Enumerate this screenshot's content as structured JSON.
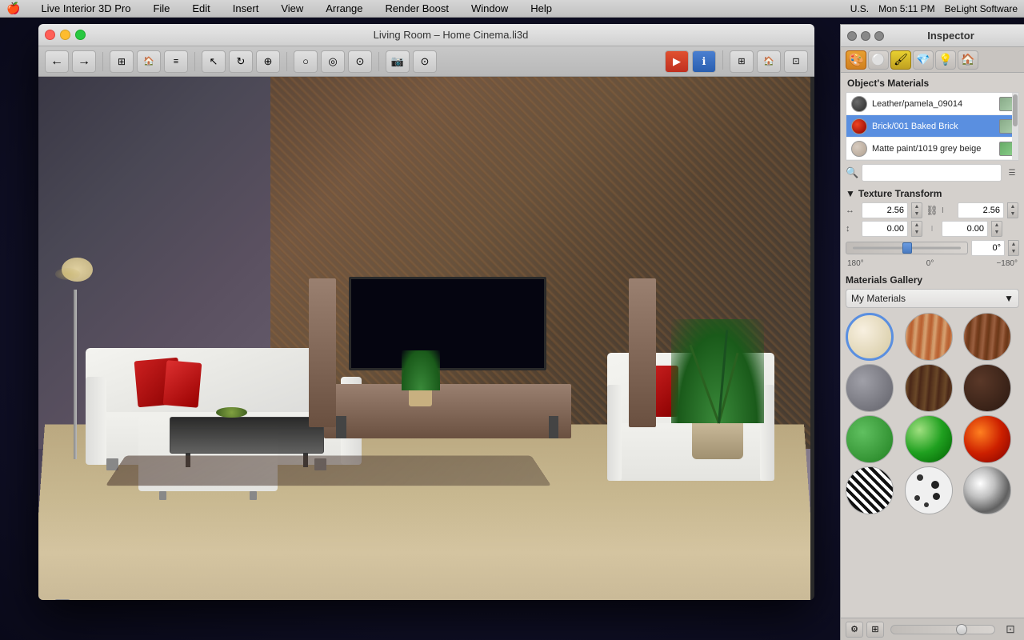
{
  "menubar": {
    "apple": "🍎",
    "app_name": "Live Interior 3D Pro",
    "menus": [
      "File",
      "Edit",
      "Insert",
      "View",
      "Arrange",
      "Render Boost",
      "Window",
      "Help"
    ],
    "right": {
      "time": "Mon 5:11 PM",
      "company": "BeLight Software",
      "locale": "U.S."
    }
  },
  "window": {
    "title": "Living Room – Home Cinema.li3d",
    "traffic_lights": [
      "close",
      "minimize",
      "maximize"
    ]
  },
  "toolbar": {
    "nav_back": "←",
    "nav_forward": "→",
    "tools": [
      "select",
      "rotate",
      "move"
    ],
    "mode_tools": [
      "circle",
      "target",
      "ring"
    ],
    "special_tools": [
      "camera",
      "screenshot"
    ],
    "info_btn": "ℹ",
    "view_btns": [
      "grid",
      "house",
      "rooms"
    ]
  },
  "inspector": {
    "title": "Inspector",
    "tabs": [
      {
        "id": "materials",
        "icon": "🎨",
        "label": "Materials",
        "active": true
      },
      {
        "id": "sphere",
        "icon": "⚪",
        "label": "Object"
      },
      {
        "id": "paint",
        "icon": "🖌️",
        "label": "Paint",
        "active_tab": true
      },
      {
        "id": "gem",
        "icon": "💎",
        "label": "Gem"
      },
      {
        "id": "bulb",
        "icon": "💡",
        "label": "Light"
      },
      {
        "id": "house",
        "icon": "🏠",
        "label": "Rooms"
      }
    ],
    "objects_materials": {
      "header": "Object's Materials",
      "items": [
        {
          "id": 1,
          "name": "Leather/pamela_09014",
          "swatch_color": "#4a4a4a",
          "selected": false
        },
        {
          "id": 2,
          "name": "Brick/001 Baked Brick",
          "swatch_color": "#cc3322",
          "selected": true
        },
        {
          "id": 3,
          "name": "Matte paint/1019 grey beige",
          "swatch_color": "#ccbbaa",
          "selected": false
        }
      ],
      "search_placeholder": ""
    },
    "texture_transform": {
      "header": "Texture Transform",
      "collapsed": false,
      "width_val": "2.56",
      "height_val": "2.56",
      "x_offset": "0.00",
      "y_offset": "0.00",
      "rotation_val": "0°",
      "rotation_left_label": "180°",
      "rotation_center_label": "0°",
      "rotation_right_label": "−180°"
    },
    "materials_gallery": {
      "header": "Materials Gallery",
      "dropdown_value": "My Materials",
      "items": [
        {
          "id": 1,
          "class": "mat-cream",
          "label": "Cream",
          "selected": true
        },
        {
          "id": 2,
          "class": "mat-wood-light",
          "label": "Light Wood"
        },
        {
          "id": 3,
          "class": "mat-wood-dark",
          "label": "Dark Wood"
        },
        {
          "id": 4,
          "class": "mat-stone",
          "label": "Stone"
        },
        {
          "id": 5,
          "class": "mat-walnut",
          "label": "Walnut"
        },
        {
          "id": 6,
          "class": "mat-dark-brown",
          "label": "Dark Brown"
        },
        {
          "id": 7,
          "class": "mat-green-matte",
          "label": "Green Matte"
        },
        {
          "id": 8,
          "class": "mat-green-glossy",
          "label": "Green Glossy"
        },
        {
          "id": 9,
          "class": "mat-fire",
          "label": "Fire"
        },
        {
          "id": 10,
          "class": "mat-zebra",
          "label": "Zebra"
        },
        {
          "id": 11,
          "class": "mat-spots",
          "label": "Spots"
        },
        {
          "id": 12,
          "class": "mat-chrome",
          "label": "Chrome"
        }
      ]
    }
  }
}
